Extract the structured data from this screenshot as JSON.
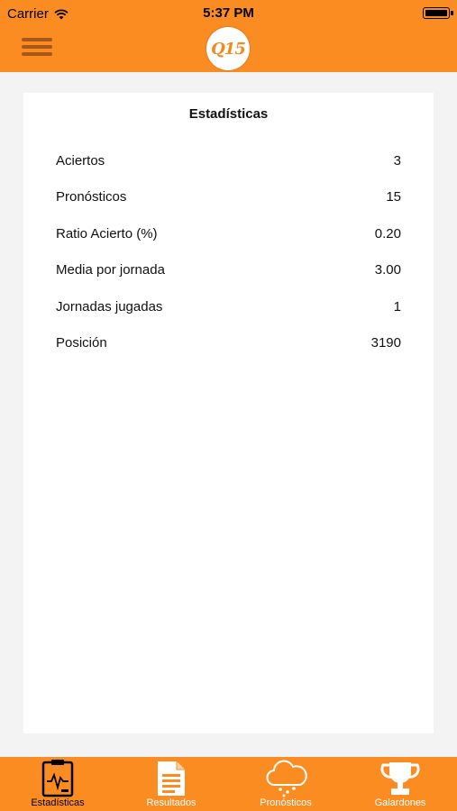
{
  "status_bar": {
    "carrier": "Carrier",
    "time": "5:37 PM"
  },
  "navbar": {
    "logo_text": "Q15"
  },
  "stats": {
    "title": "Estadísticas",
    "rows": [
      {
        "label": "Aciertos",
        "value": "3"
      },
      {
        "label": "Pronósticos",
        "value": "15"
      },
      {
        "label": "Ratio Acierto (%)",
        "value": "0.20"
      },
      {
        "label": "Media por jornada",
        "value": "3.00"
      },
      {
        "label": "Jornadas jugadas",
        "value": "1"
      },
      {
        "label": "Posición",
        "value": "3190"
      }
    ]
  },
  "tabbar": {
    "tabs": [
      {
        "label": "Estadísticas",
        "icon": "clipboard-chart-icon",
        "active": true
      },
      {
        "label": "Resultados",
        "icon": "document-icon",
        "active": false
      },
      {
        "label": "Pronósticos",
        "icon": "cloud-rain-icon",
        "active": false
      },
      {
        "label": "Galardones",
        "icon": "trophy-icon",
        "active": false
      }
    ]
  },
  "colors": {
    "brand_orange": "#fb8c22",
    "menu_brown": "#a85718"
  }
}
